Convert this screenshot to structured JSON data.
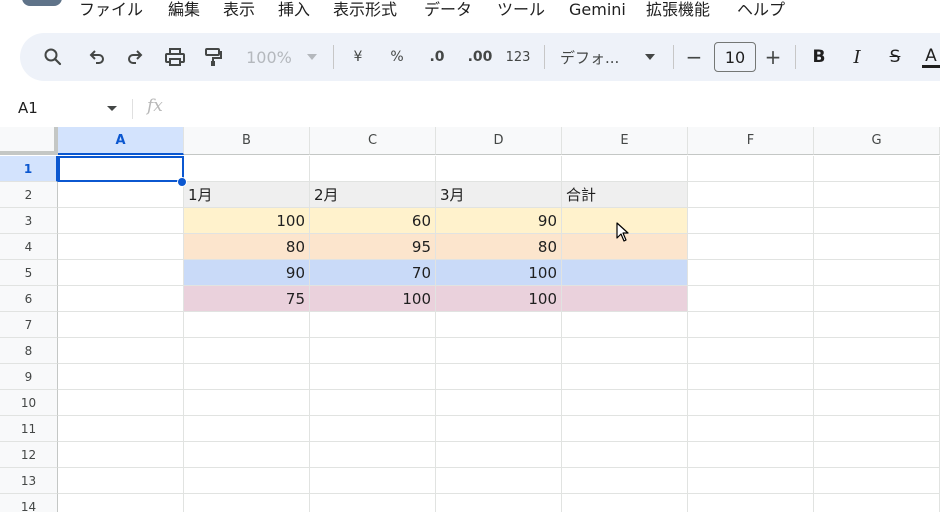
{
  "menu": {
    "items": [
      "ファイル",
      "編集",
      "表示",
      "挿入",
      "表示形式",
      "データ",
      "ツール",
      "Gemini",
      "拡張機能",
      "ヘルプ"
    ]
  },
  "toolbar": {
    "icons": [
      "search-icon",
      "undo-icon",
      "redo-icon",
      "print-icon",
      "paint-format-icon"
    ],
    "zoom": "100%",
    "currency": "¥",
    "percent": "%",
    "decrease_decimal": ".0",
    "increase_decimal": ".00",
    "number_format": "123",
    "font_name": "デフォ...",
    "font_size_decrease": "−",
    "font_size": "10",
    "font_size_increase": "+",
    "bold": "B",
    "italic": "I",
    "strikethrough": "S",
    "text_color": "A"
  },
  "formula_bar": {
    "cell_ref": "A1",
    "fx_label": "fx"
  },
  "grid": {
    "columns": [
      "A",
      "B",
      "C",
      "D",
      "E",
      "F",
      "G"
    ],
    "rows": [
      "1",
      "2",
      "3",
      "4",
      "5",
      "6",
      "7",
      "8",
      "9",
      "10",
      "11",
      "12",
      "13",
      "14"
    ],
    "selected_cell": "A1",
    "header_row": [
      "1月",
      "2月",
      "3月",
      "合計"
    ],
    "data_rows": [
      [
        "100",
        "60",
        "90",
        ""
      ],
      [
        "80",
        "95",
        "80",
        ""
      ],
      [
        "90",
        "70",
        "100",
        ""
      ],
      [
        "75",
        "100",
        "100",
        ""
      ]
    ],
    "colors": {
      "header_fill": "#efefef",
      "row_fills": [
        "#fff2cc",
        "#fce5cd",
        "#c9daf8",
        "#ead1dc"
      ],
      "selection": "#0b57d0",
      "selected_header": "#d3e3fd"
    }
  }
}
